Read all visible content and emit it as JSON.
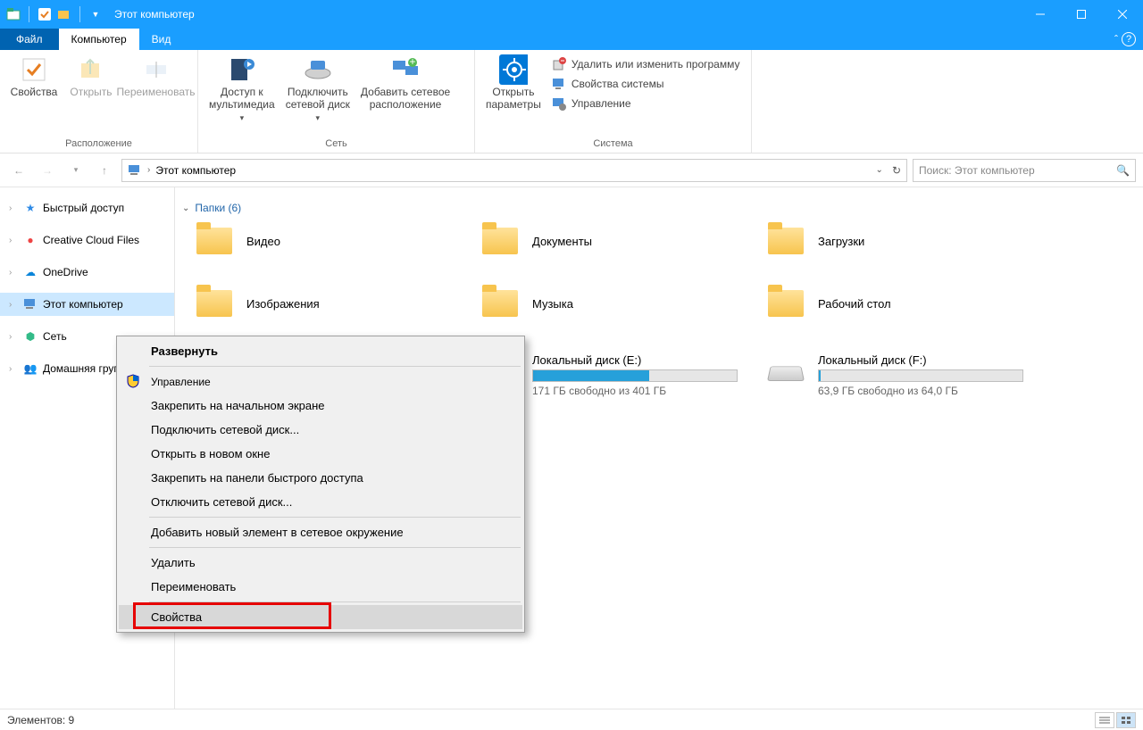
{
  "titlebar": {
    "title": "Этот компьютер"
  },
  "tabs": {
    "file": "Файл",
    "computer": "Компьютер",
    "view": "Вид"
  },
  "ribbon": {
    "group_location": "Расположение",
    "group_network": "Сеть",
    "group_system": "Система",
    "properties": "Свойства",
    "open": "Открыть",
    "rename": "Переименовать",
    "media_access": "Доступ к\nмультимедиа",
    "map_drive": "Подключить\nсетевой диск",
    "add_netloc": "Добавить сетевое\nрасположение",
    "open_settings": "Открыть\nпараметры",
    "uninstall": "Удалить или изменить программу",
    "sys_props": "Свойства системы",
    "manage": "Управление"
  },
  "address": {
    "path": "Этот компьютер"
  },
  "search": {
    "placeholder": "Поиск: Этот компьютер"
  },
  "sidebar": {
    "quick": "Быстрый доступ",
    "ccf": "Creative Cloud Files",
    "onedrive": "OneDrive",
    "thispc": "Этот компьютер",
    "network": "Сеть",
    "homegroup": "Домашняя группа"
  },
  "content": {
    "folders_header": "Папки (6)",
    "folders": [
      {
        "name": "Видео"
      },
      {
        "name": "Документы"
      },
      {
        "name": "Загрузки"
      },
      {
        "name": "Изображения"
      },
      {
        "name": "Музыка"
      },
      {
        "name": "Рабочий стол"
      }
    ],
    "drives": [
      {
        "name": "Локальный диск (E:)",
        "free": "171 ГБ свободно из 401 ГБ",
        "fill": 57
      },
      {
        "name": "Локальный диск (F:)",
        "free": "63,9 ГБ свободно из 64,0 ГБ",
        "fill": 1
      }
    ]
  },
  "context": {
    "expand": "Развернуть",
    "manage": "Управление",
    "pin_start": "Закрепить на начальном экране",
    "map_drive": "Подключить сетевой диск...",
    "open_new": "Открыть в новом окне",
    "pin_quick": "Закрепить на панели быстрого доступа",
    "disconnect": "Отключить сетевой диск...",
    "add_netplace": "Добавить новый элемент в сетевое окружение",
    "delete": "Удалить",
    "rename": "Переименовать",
    "properties": "Свойства"
  },
  "status": {
    "count": "Элементов: 9"
  }
}
